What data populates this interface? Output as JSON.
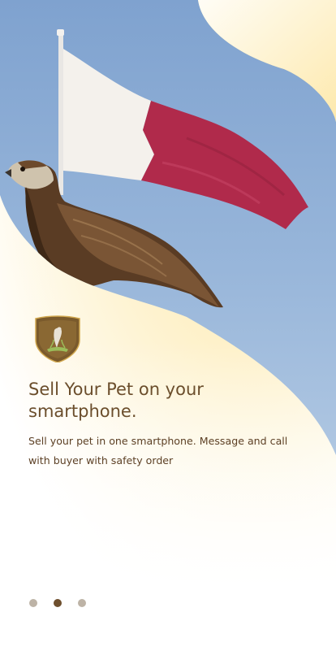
{
  "onboarding": {
    "headline": "Sell Your Pet on your smartphone.",
    "description": "Sell your pet in one smartphone. Message and call with buyer with safety order"
  },
  "pager": {
    "total": 3,
    "active_index": 1
  },
  "colors": {
    "brand_brown": "#6b4e2c",
    "cream_gradient": "#fde7a8",
    "sky": "#8eaed3",
    "flag_maroon": "#b02a4b",
    "dot_inactive": "#bdb3a6",
    "dot_active": "#6e4f2e"
  },
  "icons": {
    "logo": "falcon-shield-logo"
  }
}
